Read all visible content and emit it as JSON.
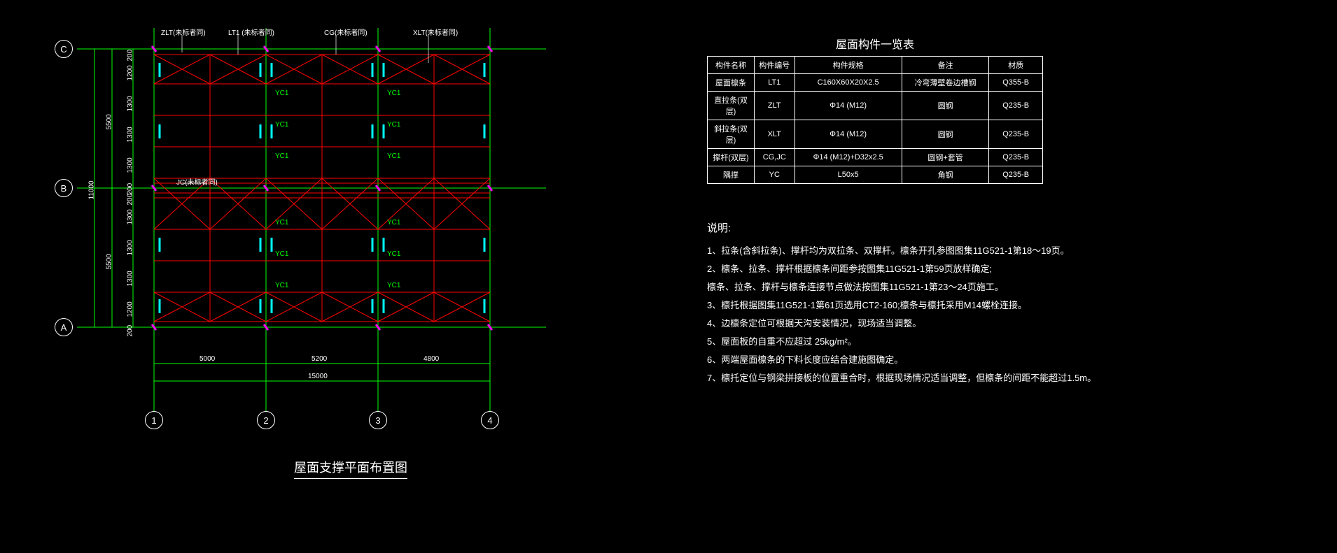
{
  "drawing": {
    "title": "屋面支撑平面布置图",
    "grid_letters": [
      "A",
      "B",
      "C"
    ],
    "grid_numbers": [
      "1",
      "2",
      "3",
      "4"
    ],
    "bay_widths": [
      "5000",
      "5200",
      "4800"
    ],
    "total_width": "15000",
    "row_spacings_top": [
      "200",
      "1200",
      "1300",
      "1300",
      "1300",
      "200"
    ],
    "row_spacings_bot": [
      "200",
      "1300",
      "1300",
      "1300",
      "1200",
      "200"
    ],
    "span_top": "5500",
    "span_bot": "5500",
    "span_total": "11000",
    "component_tags": {
      "zlt": "ZLT(未标者同)",
      "lt1": "LT1 (未标者同)",
      "cg": "CG(未标者同)",
      "xlt": "XLT(未标者同)",
      "jc": "JC(未标者同)",
      "yc1": "YC1"
    }
  },
  "table": {
    "title": "屋面构件一览表",
    "headers": [
      "构件名称",
      "构件编号",
      "构件规格",
      "备注",
      "材质"
    ],
    "rows": [
      [
        "屋面檩条",
        "LT1",
        "C160X60X20X2.5",
        "冷弯薄壁卷边槽钢",
        "Q355-B"
      ],
      [
        "直拉条(双层)",
        "ZLT",
        "Φ14 (M12)",
        "圆钢",
        "Q235-B"
      ],
      [
        "斜拉条(双层)",
        "XLT",
        "Φ14 (M12)",
        "圆钢",
        "Q235-B"
      ],
      [
        "撑杆(双层)",
        "CG,JC",
        "Φ14 (M12)+D32x2.5",
        "圆钢+套管",
        "Q235-B"
      ],
      [
        "隅撑",
        "YC",
        "L50x5",
        "角钢",
        "Q235-B"
      ]
    ]
  },
  "notes": {
    "title": "说明:",
    "lines": [
      "1、拉条(含斜拉条)、撑杆均为双拉条、双撑杆。檩条开孔参图图集11G521-1第18～19页。",
      "2、檩条、拉条、撑杆根据檩条间距参按图集11G521-1第59页放样确定;",
      "檩条、拉条、撑杆与檩条连接节点做法按图集11G521-1第23～24页施工。",
      "3、檩托根据图集11G521-1第61页选用CT2-160;檩条与檩托采用M14螺栓连接。",
      "4、边檩条定位可根据天沟安装情况，现场适当调整。",
      "5、屋面板的自重不应超过 25kg/m²。",
      "6、两端屋面檩条的下料长度应结合建施图确定。",
      "7、檩托定位与钢梁拼接板的位置重合时，根据现场情况适当调整，但檩条的间距不能超过1.5m。"
    ]
  }
}
